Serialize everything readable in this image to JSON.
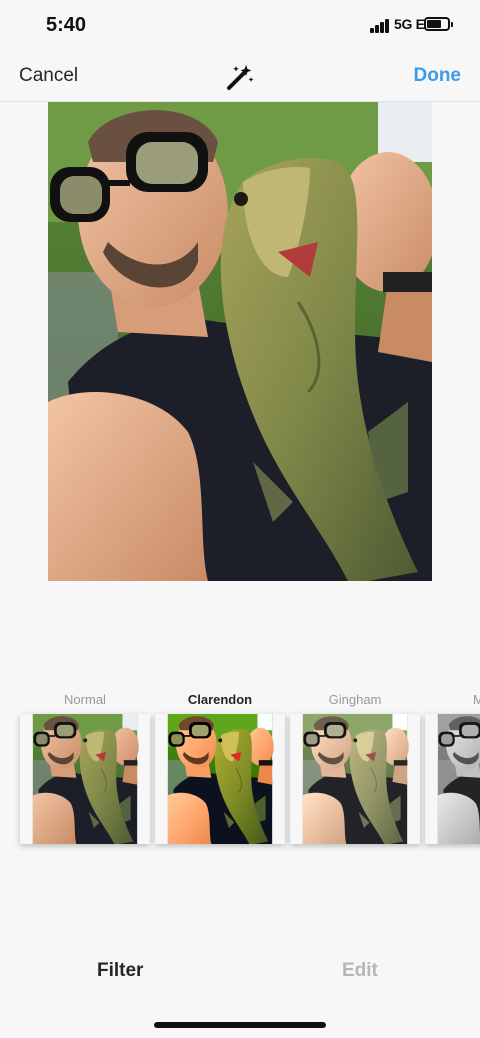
{
  "status": {
    "time": "5:40",
    "network": "5G E"
  },
  "nav": {
    "cancel": "Cancel",
    "magic_icon": "magic-wand-icon",
    "done": "Done",
    "done_color": "#3f9ae6"
  },
  "filters": [
    {
      "label": "Normal",
      "selected": false
    },
    {
      "label": "Clarendon",
      "selected": true
    },
    {
      "label": "Gingham",
      "selected": false
    },
    {
      "label": "M",
      "selected": false
    }
  ],
  "tabs": {
    "filter": "Filter",
    "edit": "Edit"
  }
}
